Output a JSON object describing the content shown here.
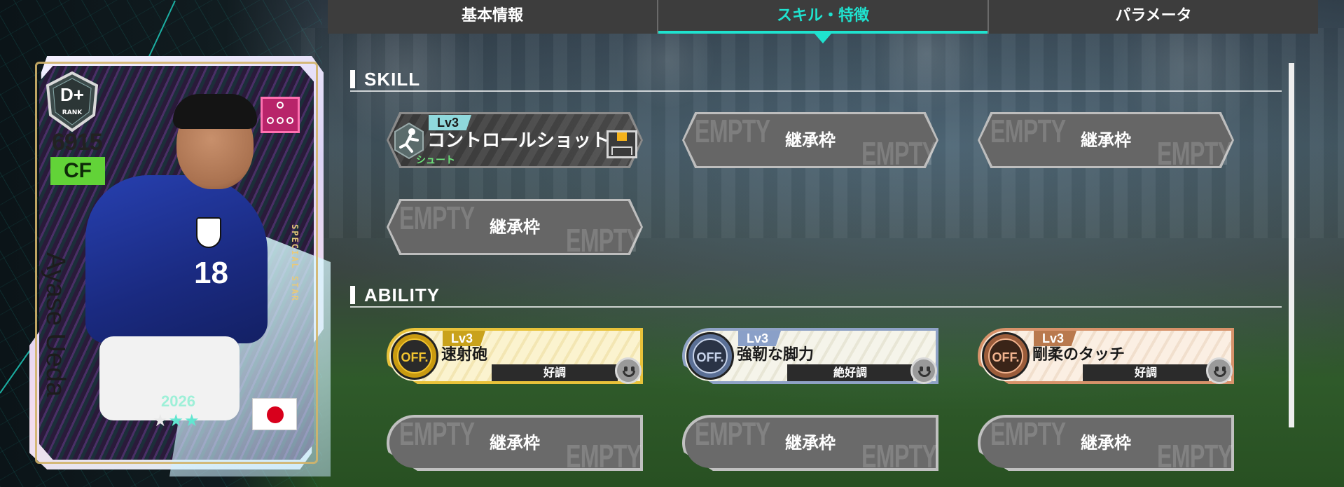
{
  "tabs": [
    {
      "label": "基本情報"
    },
    {
      "label": "スキル・特徴"
    },
    {
      "label": "パラメータ"
    }
  ],
  "active_tab_index": 1,
  "card": {
    "rank": "D+",
    "rank_sub": "RANK",
    "rating": "6915",
    "position": "CF",
    "name": "Ayase Ueda",
    "edition": "SPECIAL STAR",
    "year": "2026",
    "jersey_number": "18",
    "stars": 3,
    "flag": "japan-flag",
    "colors": {
      "position": "#62d338",
      "accent": "#1fe2cf"
    }
  },
  "skill_section": {
    "title": "SKILL",
    "slots": [
      {
        "type": "filled",
        "level": "Lv3",
        "name": "コントロールショット",
        "category": "シュート",
        "icon": "kick-icon",
        "target_icon": "goal-icon"
      },
      {
        "type": "empty",
        "label": "継承枠",
        "watermark": "EMPTY"
      },
      {
        "type": "empty",
        "label": "継承枠",
        "watermark": "EMPTY"
      },
      {
        "type": "empty",
        "label": "継承枠",
        "watermark": "EMPTY"
      }
    ]
  },
  "ability_section": {
    "title": "ABILITY",
    "slots": [
      {
        "type": "filled",
        "tier": "gold",
        "level": "Lv3",
        "badge": "OFF.",
        "name": "速射砲",
        "condition": "好調",
        "mood_icon": "smile-face-icon"
      },
      {
        "type": "filled",
        "tier": "silver",
        "level": "Lv3",
        "badge": "OFF.",
        "name": "強靭な脚力",
        "condition": "絶好調",
        "mood_icon": "smile-face-icon"
      },
      {
        "type": "filled",
        "tier": "bronze",
        "level": "Lv3",
        "badge": "OFF.",
        "name": "剛柔のタッチ",
        "condition": "好調",
        "mood_icon": "smile-face-icon"
      },
      {
        "type": "empty",
        "label": "継承枠",
        "watermark": "EMPTY"
      },
      {
        "type": "empty",
        "label": "継承枠",
        "watermark": "EMPTY"
      },
      {
        "type": "empty",
        "label": "継承枠",
        "watermark": "EMPTY"
      }
    ]
  }
}
